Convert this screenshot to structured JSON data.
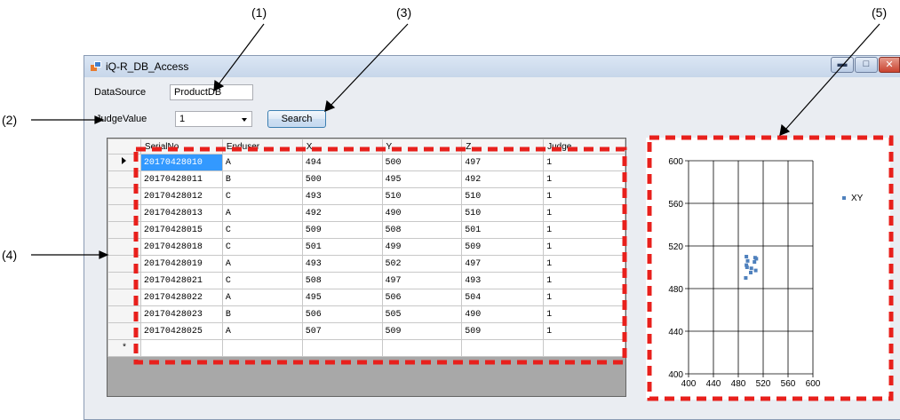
{
  "callouts": [
    "(1)",
    "(2)",
    "(3)",
    "(4)",
    "(5)"
  ],
  "window": {
    "title": "iQ-R_DB_Access",
    "minimize_glyph": "▬",
    "maximize_glyph": "□",
    "close_glyph": "✕"
  },
  "form": {
    "datasource_label": "DataSource",
    "datasource_value": "ProductDB",
    "judge_label": "JudgeValue",
    "judge_value": "1",
    "search_label": "Search"
  },
  "grid": {
    "columns": [
      "SerialNo",
      "Enduser",
      "X",
      "Y",
      "Z",
      "Judge"
    ],
    "rows": [
      [
        "20170428010",
        "A",
        "494",
        "500",
        "497",
        "1"
      ],
      [
        "20170428011",
        "B",
        "500",
        "495",
        "492",
        "1"
      ],
      [
        "20170428012",
        "C",
        "493",
        "510",
        "510",
        "1"
      ],
      [
        "20170428013",
        "A",
        "492",
        "490",
        "510",
        "1"
      ],
      [
        "20170428015",
        "C",
        "509",
        "508",
        "501",
        "1"
      ],
      [
        "20170428018",
        "C",
        "501",
        "499",
        "509",
        "1"
      ],
      [
        "20170428019",
        "A",
        "493",
        "502",
        "497",
        "1"
      ],
      [
        "20170428021",
        "C",
        "508",
        "497",
        "493",
        "1"
      ],
      [
        "20170428022",
        "A",
        "495",
        "506",
        "504",
        "1"
      ],
      [
        "20170428023",
        "B",
        "506",
        "505",
        "490",
        "1"
      ],
      [
        "20170428025",
        "A",
        "507",
        "509",
        "509",
        "1"
      ]
    ],
    "new_row_marker": "*"
  },
  "chart_data": {
    "type": "scatter",
    "series": [
      {
        "name": "XY",
        "color": "#4f81bd",
        "points": [
          [
            494,
            500
          ],
          [
            500,
            495
          ],
          [
            493,
            510
          ],
          [
            492,
            490
          ],
          [
            509,
            508
          ],
          [
            501,
            499
          ],
          [
            493,
            502
          ],
          [
            508,
            497
          ],
          [
            495,
            506
          ],
          [
            506,
            505
          ],
          [
            507,
            509
          ]
        ]
      }
    ],
    "xlim": [
      400,
      600
    ],
    "ylim": [
      400,
      600
    ],
    "xticks": [
      "400",
      "440",
      "480",
      "520",
      "560",
      "600"
    ],
    "yticks": [
      "400",
      "440",
      "480",
      "520",
      "560",
      "600"
    ],
    "legend_position": "top-right",
    "grid": true
  },
  "colors": {
    "annotation_red": "#e8201c",
    "selection_blue": "#3399ff"
  }
}
